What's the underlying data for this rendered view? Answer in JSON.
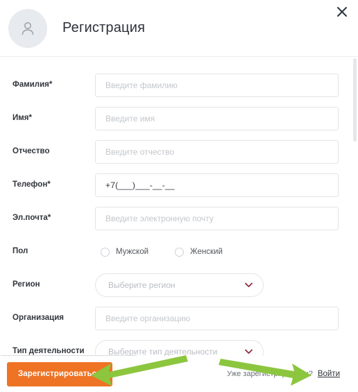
{
  "header": {
    "title": "Регистрация",
    "avatar_icon": "user-avatar-icon",
    "close_icon": "close-icon"
  },
  "form": {
    "fields": [
      {
        "label": "Фамилия",
        "required": true,
        "type": "text",
        "placeholder": "Введите фамилию",
        "value": "",
        "name": "lastname"
      },
      {
        "label": "Имя",
        "required": true,
        "type": "text",
        "placeholder": "Введите имя",
        "value": "",
        "name": "firstname"
      },
      {
        "label": "Отчество",
        "required": false,
        "type": "text",
        "placeholder": "Введите отчество",
        "value": "",
        "name": "middlename"
      },
      {
        "label": "Телефон",
        "required": true,
        "type": "text",
        "placeholder": "",
        "value": "+7(___)___-__-__",
        "name": "phone"
      },
      {
        "label": "Эл.почта",
        "required": true,
        "type": "text",
        "placeholder": "Введите электронную почту",
        "value": "",
        "name": "email"
      },
      {
        "label": "Пол",
        "required": false,
        "type": "radio",
        "name": "gender",
        "options": [
          {
            "label": "Мужской",
            "selected": false
          },
          {
            "label": "Женский",
            "selected": false
          }
        ]
      },
      {
        "label": "Регион",
        "required": false,
        "type": "select",
        "placeholder": "Выберите регион",
        "value": "",
        "name": "region",
        "chevron_icon": "chevron-down-icon"
      },
      {
        "label": "Организация",
        "required": false,
        "type": "text",
        "placeholder": "Введите организацию",
        "value": "",
        "name": "organization"
      },
      {
        "label": "Тип деятельности",
        "required": false,
        "type": "select",
        "placeholder": "Выберите тип деятельности",
        "value": "",
        "name": "activity-type",
        "chevron_icon": "chevron-down-icon"
      }
    ],
    "required_marker": "*"
  },
  "footer": {
    "register_label": "Зарегистрироваться",
    "already_registered_text": "Уже зарегистрированы?",
    "login_label": "Войти"
  },
  "annotations": {
    "arrow_color": "#8cc63e",
    "arrow_to_register": "arrow-pointing-to-register-button",
    "arrow_to_login": "arrow-pointing-to-login-link"
  },
  "colors": {
    "accent_orange": "#ee7324",
    "annotation_green": "#8cc63e",
    "border_gray": "#e2e4e7",
    "placeholder_gray": "#c3c7cc",
    "label_dark": "#31353c",
    "avatar_bg": "#e7eaee",
    "chevron_maroon": "#8e2b3e"
  }
}
